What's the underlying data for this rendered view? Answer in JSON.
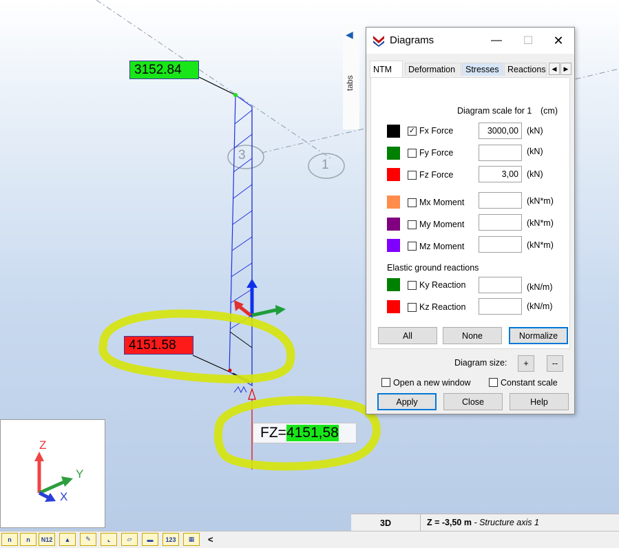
{
  "viewport": {
    "top_label": "3152.84",
    "left_label": "4151.58",
    "node_label_3": "3",
    "node_label_1": "1",
    "fz_prefix": "FZ=",
    "fz_value": "4151,58",
    "colors": {
      "green_label": "#19e619",
      "red_label": "#ff1a1a",
      "highlight": "#ecf20a",
      "blue_line": "#2030e0",
      "green_line": "#2a6b2a"
    }
  },
  "tabs_bar": {
    "label": "tabs"
  },
  "dialog": {
    "title": "Diagrams",
    "tabs": [
      "NTM",
      "Deformation",
      "Stresses",
      "Reactions"
    ],
    "scale_label": "Diagram scale for 1",
    "scale_unit": "(cm)",
    "rows": [
      {
        "label": "Fx Force",
        "checked": true,
        "value": "3000,00",
        "unit": "(kN)",
        "color": "#000000"
      },
      {
        "label": "Fy Force",
        "checked": false,
        "value": "",
        "unit": "(kN)",
        "color": "#008000"
      },
      {
        "label": "Fz Force",
        "checked": false,
        "value": "3,00",
        "unit": "(kN)",
        "color": "#ff0000"
      },
      {
        "label": "Mx Moment",
        "checked": false,
        "value": "",
        "unit": "(kN*m)",
        "color": "#ff8c4a"
      },
      {
        "label": "My Moment",
        "checked": false,
        "value": "",
        "unit": "(kN*m)",
        "color": "#800080"
      },
      {
        "label": "Mz Moment",
        "checked": false,
        "value": "",
        "unit": "(kN*m)",
        "color": "#8000ff"
      }
    ],
    "ground_title": "Elastic ground reactions",
    "ground_rows": [
      {
        "label": "Ky Reaction",
        "checked": false,
        "value": "",
        "unit": "(kN/m)",
        "color": "#008000"
      },
      {
        "label": "Kz Reaction",
        "checked": false,
        "value": "",
        "unit": "(kN/m)",
        "color": "#ff0000"
      }
    ],
    "buttons": {
      "all": "All",
      "none": "None",
      "normalize": "Normalize"
    },
    "diagram_size_label": "Diagram size:",
    "size_plus": "+",
    "size_minus": "--",
    "open_new_window": "Open a new window",
    "constant_scale": "Constant scale",
    "apply": "Apply",
    "close": "Close",
    "help": "Help"
  },
  "axis_widget": {
    "z": "Z",
    "y": "Y",
    "x": "X"
  },
  "status": {
    "view": "3D",
    "z_value": "Z = -3,50 m",
    "z_desc": " - Structure axis 1"
  },
  "toolbar": {
    "items": [
      "n",
      "n",
      "N12",
      "",
      "",
      "",
      "",
      "",
      "123",
      ""
    ],
    "scroll_left": "<"
  }
}
